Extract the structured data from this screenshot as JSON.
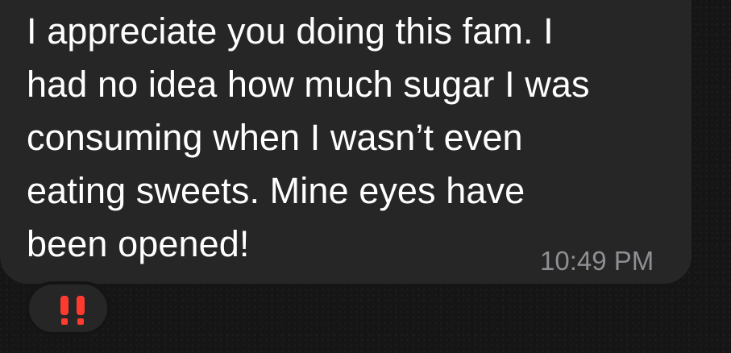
{
  "message": {
    "lines": [
      "I appreciate you doing this fam. I",
      "had no idea how much sugar I was",
      "consuming when I wasn’t even",
      "eating sweets. Mine eyes have",
      "been opened!"
    ],
    "timestamp": "10:49 PM"
  },
  "reaction": {
    "icon": "double-exclamation-icon",
    "color": "#ff3b30"
  },
  "colors": {
    "background": "#151515",
    "bubble": "#262626",
    "text": "#ffffff",
    "timestamp": "#8e8e93"
  }
}
